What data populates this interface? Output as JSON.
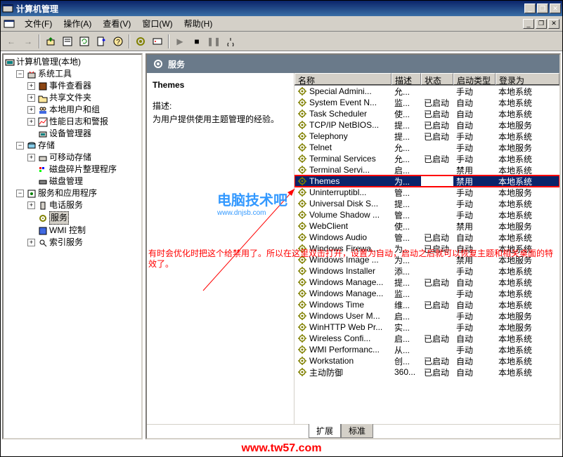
{
  "window": {
    "title": "计算机管理",
    "min": "_",
    "max": "❐",
    "close": "✕"
  },
  "menu": {
    "file": "文件(F)",
    "action": "操作(A)",
    "view": "查看(V)",
    "window": "窗口(W)",
    "help": "帮助(H)"
  },
  "tree": {
    "root": "计算机管理(本地)",
    "sys_tools": "系统工具",
    "event_viewer": "事件查看器",
    "shared_folders": "共享文件夹",
    "local_users": "本地用户和组",
    "perf_logs": "性能日志和警报",
    "device_mgr": "设备管理器",
    "storage": "存储",
    "removable": "可移动存储",
    "defrag": "磁盘碎片整理程序",
    "disk_mgmt": "磁盘管理",
    "services_apps": "服务和应用程序",
    "telephony": "电话服务",
    "services": "服务",
    "wmi": "WMI 控制",
    "indexing": "索引服务"
  },
  "content": {
    "header": "服务",
    "selected_name": "Themes",
    "desc_label": "描述:",
    "desc_text": "为用户提供使用主题管理的经验。"
  },
  "columns": {
    "name": "名称",
    "desc": "描述",
    "status": "状态",
    "startup": "启动类型",
    "logon": "登录为"
  },
  "services": [
    {
      "name": "Special Admini...",
      "desc": "允...",
      "status": "",
      "startup": "手动",
      "logon": "本地系统",
      "sel": false
    },
    {
      "name": "System Event N...",
      "desc": "监...",
      "status": "已启动",
      "startup": "自动",
      "logon": "本地系统",
      "sel": false
    },
    {
      "name": "Task Scheduler",
      "desc": "使...",
      "status": "已启动",
      "startup": "自动",
      "logon": "本地系统",
      "sel": false
    },
    {
      "name": "TCP/IP NetBIOS...",
      "desc": "提...",
      "status": "已启动",
      "startup": "自动",
      "logon": "本地服务",
      "sel": false
    },
    {
      "name": "Telephony",
      "desc": "提...",
      "status": "已启动",
      "startup": "手动",
      "logon": "本地系统",
      "sel": false
    },
    {
      "name": "Telnet",
      "desc": "允...",
      "status": "",
      "startup": "手动",
      "logon": "本地服务",
      "sel": false
    },
    {
      "name": "Terminal Services",
      "desc": "允...",
      "status": "已启动",
      "startup": "手动",
      "logon": "本地系统",
      "sel": false
    },
    {
      "name": "Terminal Servi...",
      "desc": "启...",
      "status": "",
      "startup": "禁用",
      "logon": "本地系统",
      "sel": false
    },
    {
      "name": "Themes",
      "desc": "为...",
      "status": "",
      "startup": "禁用",
      "logon": "本地系统",
      "sel": true,
      "hl": true
    },
    {
      "name": "Uninterruptibl...",
      "desc": "管...",
      "status": "",
      "startup": "手动",
      "logon": "本地服务",
      "sel": false
    },
    {
      "name": "Universal Disk S...",
      "desc": "提...",
      "status": "",
      "startup": "手动",
      "logon": "本地系统",
      "sel": false
    },
    {
      "name": "Volume Shadow ...",
      "desc": "管...",
      "status": "",
      "startup": "手动",
      "logon": "本地系统",
      "sel": false
    },
    {
      "name": "WebClient",
      "desc": "使...",
      "status": "",
      "startup": "禁用",
      "logon": "本地服务",
      "sel": false
    },
    {
      "name": "Windows Audio",
      "desc": "管...",
      "status": "已启动",
      "startup": "自动",
      "logon": "本地系统",
      "sel": false
    },
    {
      "name": "Windows Firewa...",
      "desc": "为...",
      "status": "已启动",
      "startup": "自动",
      "logon": "本地系统",
      "sel": false
    },
    {
      "name": "Windows Image ...",
      "desc": "为...",
      "status": "",
      "startup": "禁用",
      "logon": "本地服务",
      "sel": false
    },
    {
      "name": "Windows Installer",
      "desc": "添...",
      "status": "",
      "startup": "手动",
      "logon": "本地系统",
      "sel": false
    },
    {
      "name": "Windows Manage...",
      "desc": "提...",
      "status": "已启动",
      "startup": "自动",
      "logon": "本地系统",
      "sel": false
    },
    {
      "name": "Windows Manage...",
      "desc": "监...",
      "status": "",
      "startup": "手动",
      "logon": "本地系统",
      "sel": false
    },
    {
      "name": "Windows Time",
      "desc": "维...",
      "status": "已启动",
      "startup": "自动",
      "logon": "本地系统",
      "sel": false
    },
    {
      "name": "Windows User M...",
      "desc": "启...",
      "status": "",
      "startup": "手动",
      "logon": "本地服务",
      "sel": false
    },
    {
      "name": "WinHTTP Web Pr...",
      "desc": "实...",
      "status": "",
      "startup": "手动",
      "logon": "本地服务",
      "sel": false
    },
    {
      "name": "Wireless Confi...",
      "desc": "启...",
      "status": "已启动",
      "startup": "自动",
      "logon": "本地系统",
      "sel": false
    },
    {
      "name": "WMI Performanc...",
      "desc": "从...",
      "status": "",
      "startup": "手动",
      "logon": "本地系统",
      "sel": false
    },
    {
      "name": "Workstation",
      "desc": "创...",
      "status": "已启动",
      "startup": "自动",
      "logon": "本地系统",
      "sel": false
    },
    {
      "name": "主动防御",
      "desc": "360...",
      "status": "已启动",
      "startup": "自动",
      "logon": "本地系统",
      "sel": false
    }
  ],
  "tabs": {
    "extended": "扩展",
    "standard": "标准"
  },
  "annotations": {
    "note": "有时会优化时把这个给禁用了。所以在这里双击打开，设置为自动，启动之后就可以恢复主题和相关桌面的特效了。",
    "watermark1": "电脑技术吧",
    "watermark2": "www.dnjsb.com",
    "footer": "www.tw57.com"
  }
}
